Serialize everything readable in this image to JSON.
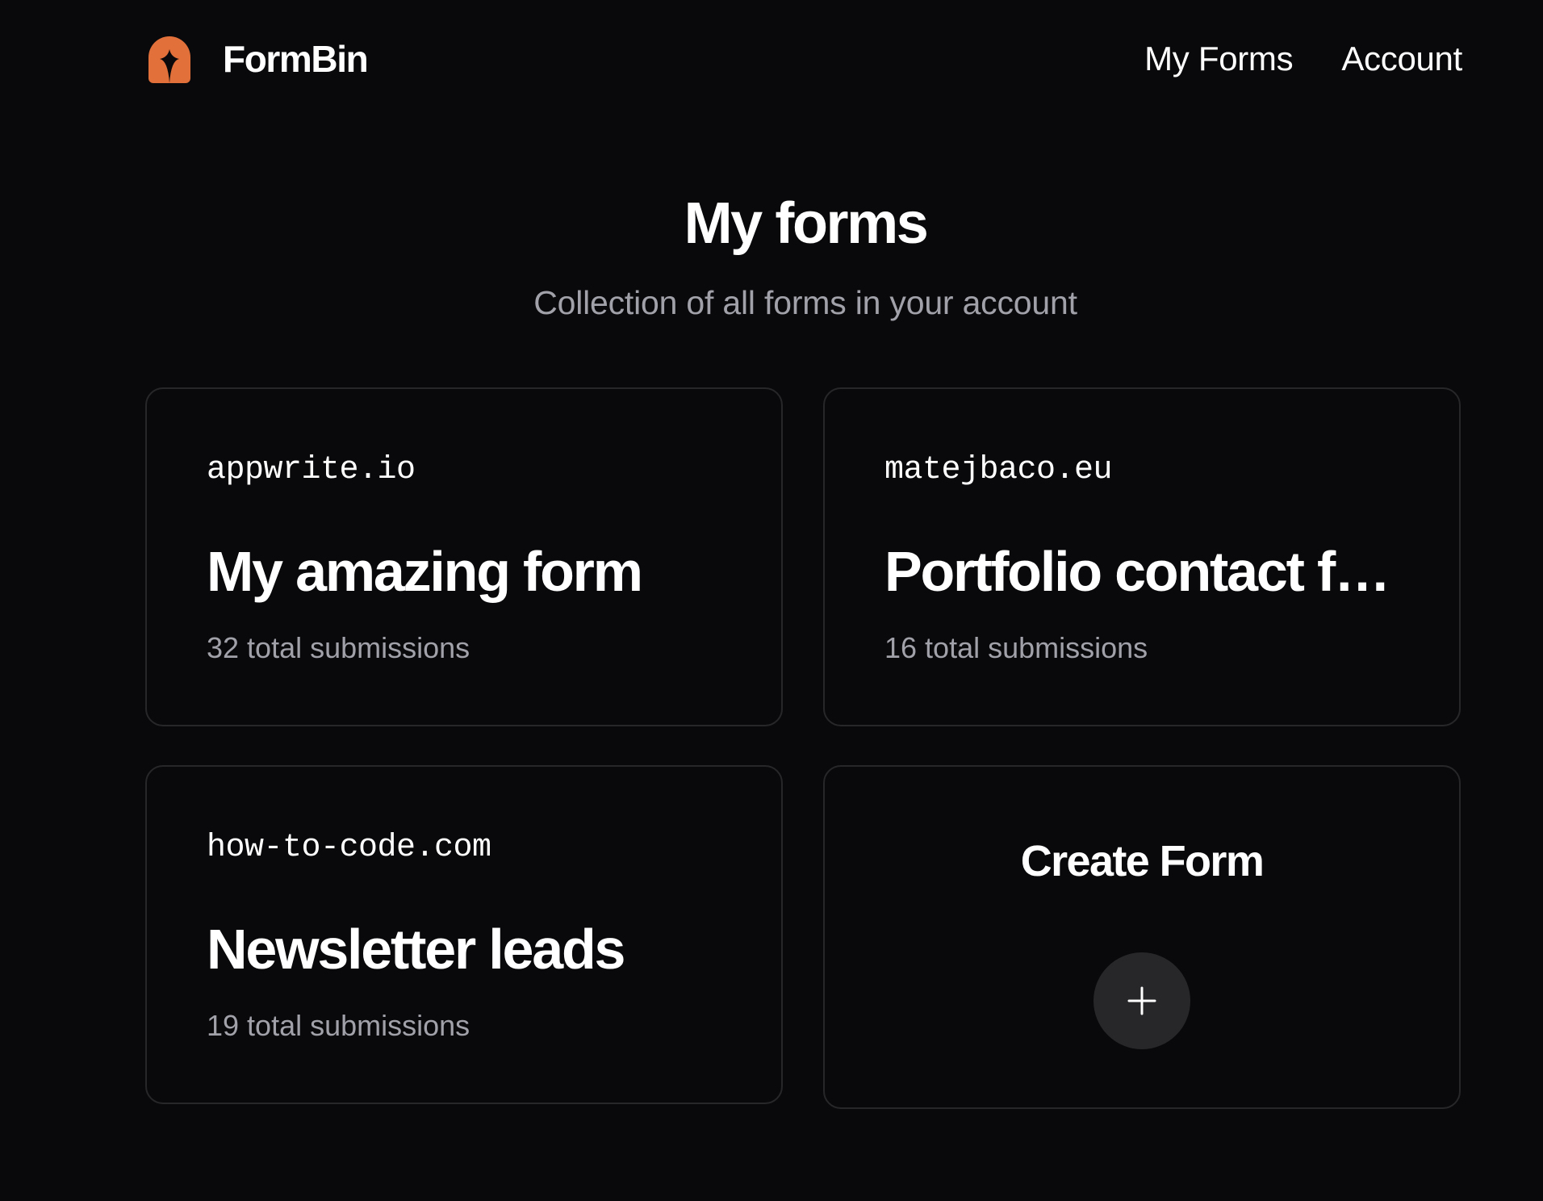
{
  "header": {
    "brand_name": "FormBin",
    "logo_icon": "formbin-logo-icon",
    "nav": {
      "my_forms": "My Forms",
      "account": "Account"
    }
  },
  "main": {
    "title": "My forms",
    "subtitle": "Collection of all forms in your account",
    "forms": [
      {
        "domain": "appwrite.io",
        "name": "My amazing form",
        "submissions": "32 total submissions"
      },
      {
        "domain": "matejbaco.eu",
        "name": "Portfolio contact form",
        "submissions": "16 total submissions"
      },
      {
        "domain": "how-to-code.com",
        "name": "Newsletter leads",
        "submissions": "19 total submissions"
      }
    ],
    "create": {
      "label": "Create Form",
      "icon": "plus-icon"
    }
  },
  "colors": {
    "background": "#09090b",
    "card_border": "#27272a",
    "muted_text": "#a1a1aa",
    "accent": "#e2703a",
    "button_bg": "#27272a"
  }
}
